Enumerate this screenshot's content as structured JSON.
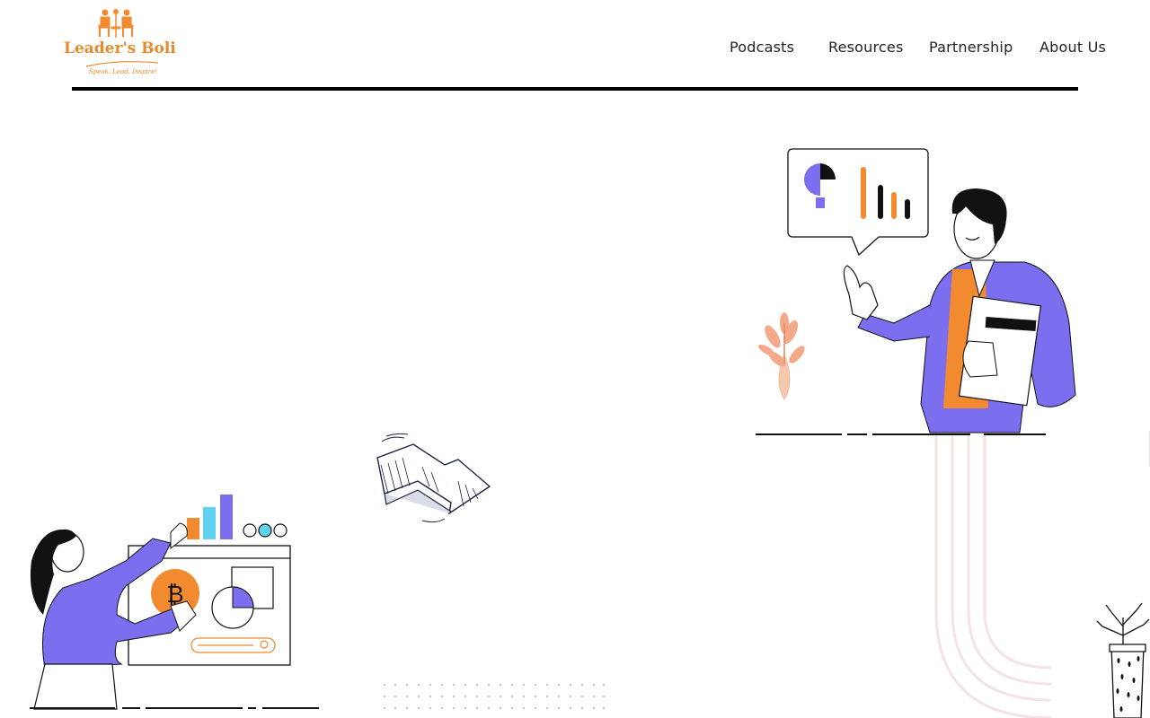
{
  "brand": {
    "name": "Leader's Boli",
    "tagline": "Speak. Lead. Inspire!",
    "accent": "#f28a30"
  },
  "nav": {
    "items": [
      {
        "label": "Podcasts"
      },
      {
        "label": "Resources"
      },
      {
        "label": "Partnership"
      },
      {
        "label": "About Us"
      }
    ]
  },
  "colors": {
    "purple": "#7b6ff0",
    "orange": "#f28a30",
    "cyan": "#5fd3f0",
    "ink": "#111111",
    "arc": "#f3e4e6"
  },
  "icons": [
    "podcast-logo-icon",
    "presenter-illustration",
    "arrow-illustration",
    "analyst-illustration",
    "plant-illustration"
  ]
}
